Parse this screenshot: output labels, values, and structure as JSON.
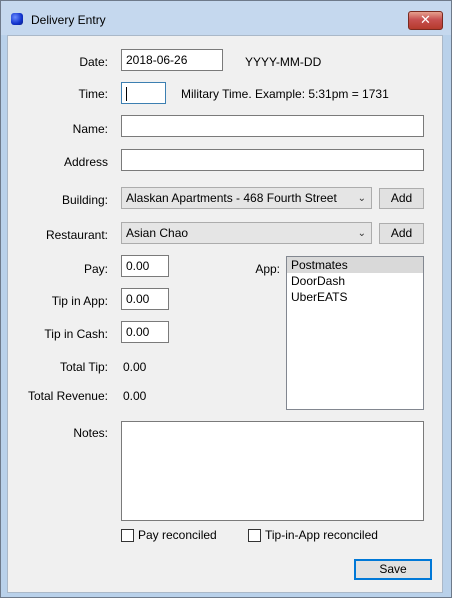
{
  "window": {
    "title": "Delivery Entry",
    "close_glyph": "✕"
  },
  "date": {
    "label": "Date:",
    "value": "2018-06-26",
    "hint": "YYYY-MM-DD"
  },
  "time": {
    "label": "Time:",
    "value": "",
    "hint": "Military Time. Example: 5:31pm = 1731"
  },
  "name": {
    "label": "Name:",
    "value": ""
  },
  "address": {
    "label": "Address",
    "value": ""
  },
  "building": {
    "label": "Building:",
    "selected": "Alaskan Apartments - 468 Fourth Street",
    "add_label": "Add"
  },
  "restaurant": {
    "label": "Restaurant:",
    "selected": "Asian Chao",
    "add_label": "Add"
  },
  "pay": {
    "label": "Pay:",
    "value": "0.00"
  },
  "tip_in_app": {
    "label": "Tip in App:",
    "value": "0.00"
  },
  "tip_in_cash": {
    "label": "Tip in Cash:",
    "value": "0.00"
  },
  "total_tip": {
    "label": "Total Tip:",
    "value": "0.00"
  },
  "total_revenue": {
    "label": "Total Revenue:",
    "value": "0.00"
  },
  "app": {
    "label": "App:",
    "options": [
      "Postmates",
      "DoorDash",
      "UberEATS"
    ],
    "selected_index": 0
  },
  "notes": {
    "label": "Notes:",
    "value": ""
  },
  "pay_reconciled": {
    "label": "Pay reconciled",
    "checked": false
  },
  "tip_reconciled": {
    "label": "Tip-in-App reconciled",
    "checked": false
  },
  "save_label": "Save",
  "icons": {
    "app": "app-icon",
    "close": "close-icon",
    "dropdown": "chevron-down-icon"
  }
}
